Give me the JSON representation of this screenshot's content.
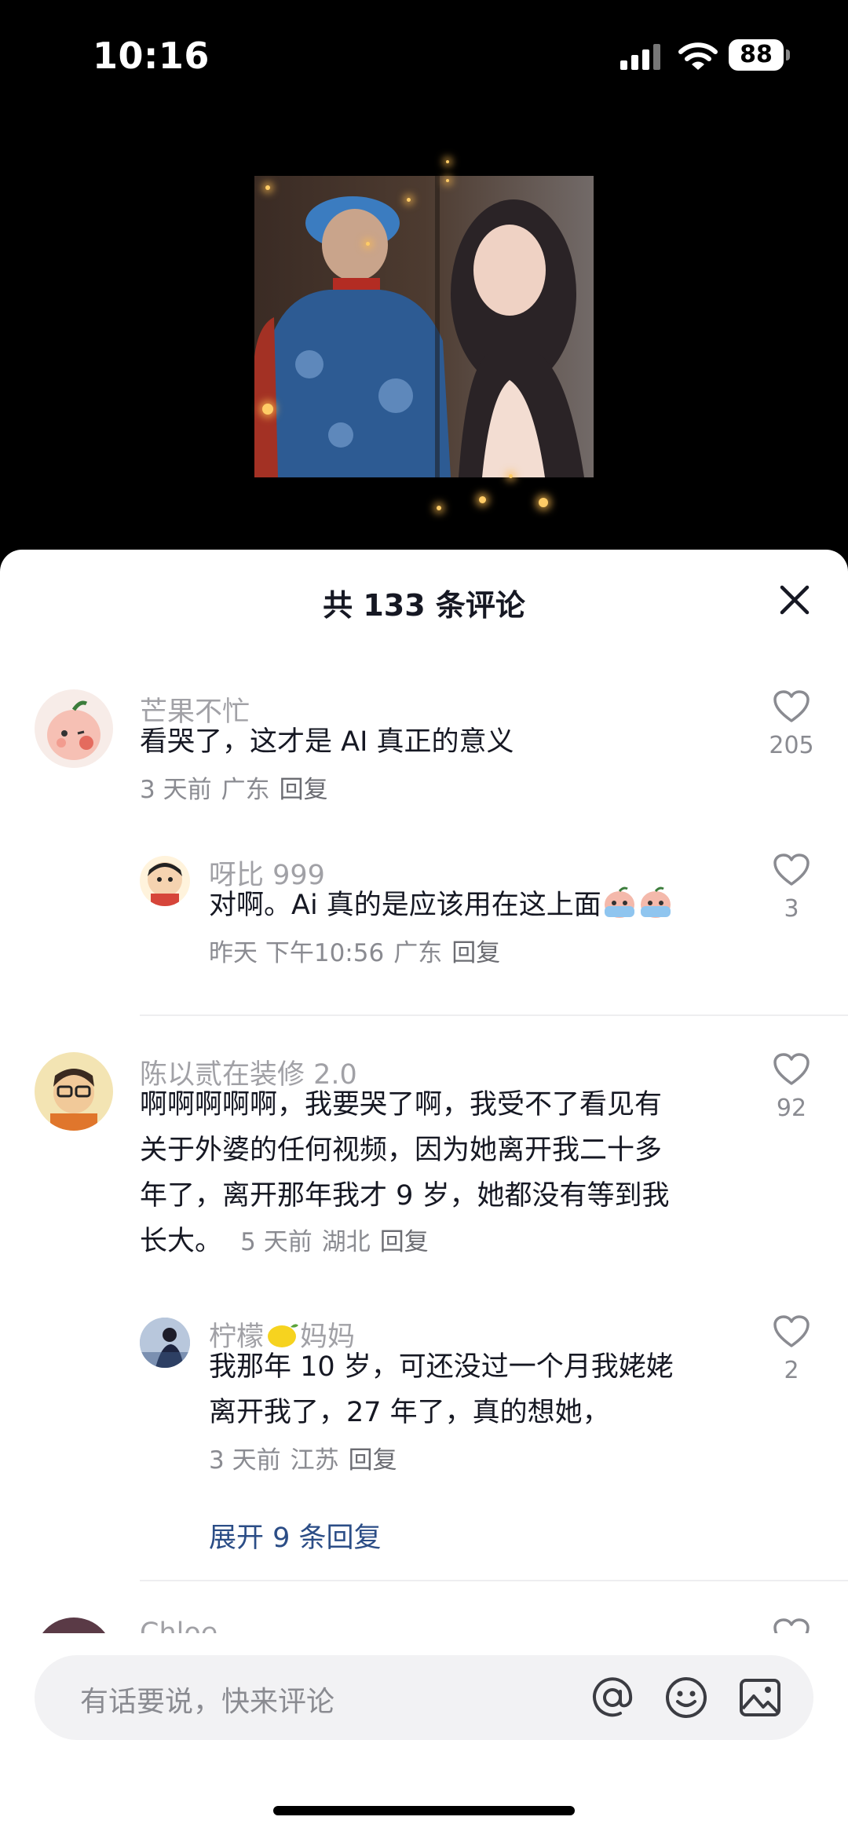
{
  "status": {
    "time": "10:16",
    "battery": "88"
  },
  "sheet": {
    "title": "共 133 条评论"
  },
  "comments": [
    {
      "user": "芒果不忙",
      "text": "看哭了，这才是 AI 真正的意义",
      "time": "3 天前",
      "location": "广东",
      "reply": "回复",
      "likes": "205"
    },
    {
      "user": "呀比 999",
      "text": "对啊。Ai 真的是应该用在这上面",
      "time": "昨天 下午10:56",
      "location": "广东",
      "reply": "回复",
      "likes": "3"
    },
    {
      "user": "陈以贰在装修 2.0",
      "text_lines": [
        "啊啊啊啊啊，我要哭了啊，我受不了看见有",
        "关于外婆的任何视频，因为她离开我二十多",
        "年了，离开那年我才 9 岁，她都没有等到我",
        "长大。"
      ],
      "time": "5 天前",
      "location": "湖北",
      "reply": "回复",
      "likes": "92"
    },
    {
      "user_prefix": "柠檬",
      "user_suffix": "妈妈",
      "text_lines": [
        "我那年 10 岁，可还没过一个月我姥姥",
        "离开我了，27 年了，真的想她，"
      ],
      "time": "3 天前",
      "location": "江苏",
      "reply": "回复",
      "likes": "2"
    },
    {
      "user": "Chloe"
    }
  ],
  "expand_replies": "展开 9 条回复",
  "input": {
    "placeholder": "有话要说，快来评论"
  },
  "icons": {
    "close": "close-icon",
    "like": "heart-outline-icon",
    "mention": "at-icon",
    "emoji": "smiley-icon",
    "image": "image-icon"
  }
}
